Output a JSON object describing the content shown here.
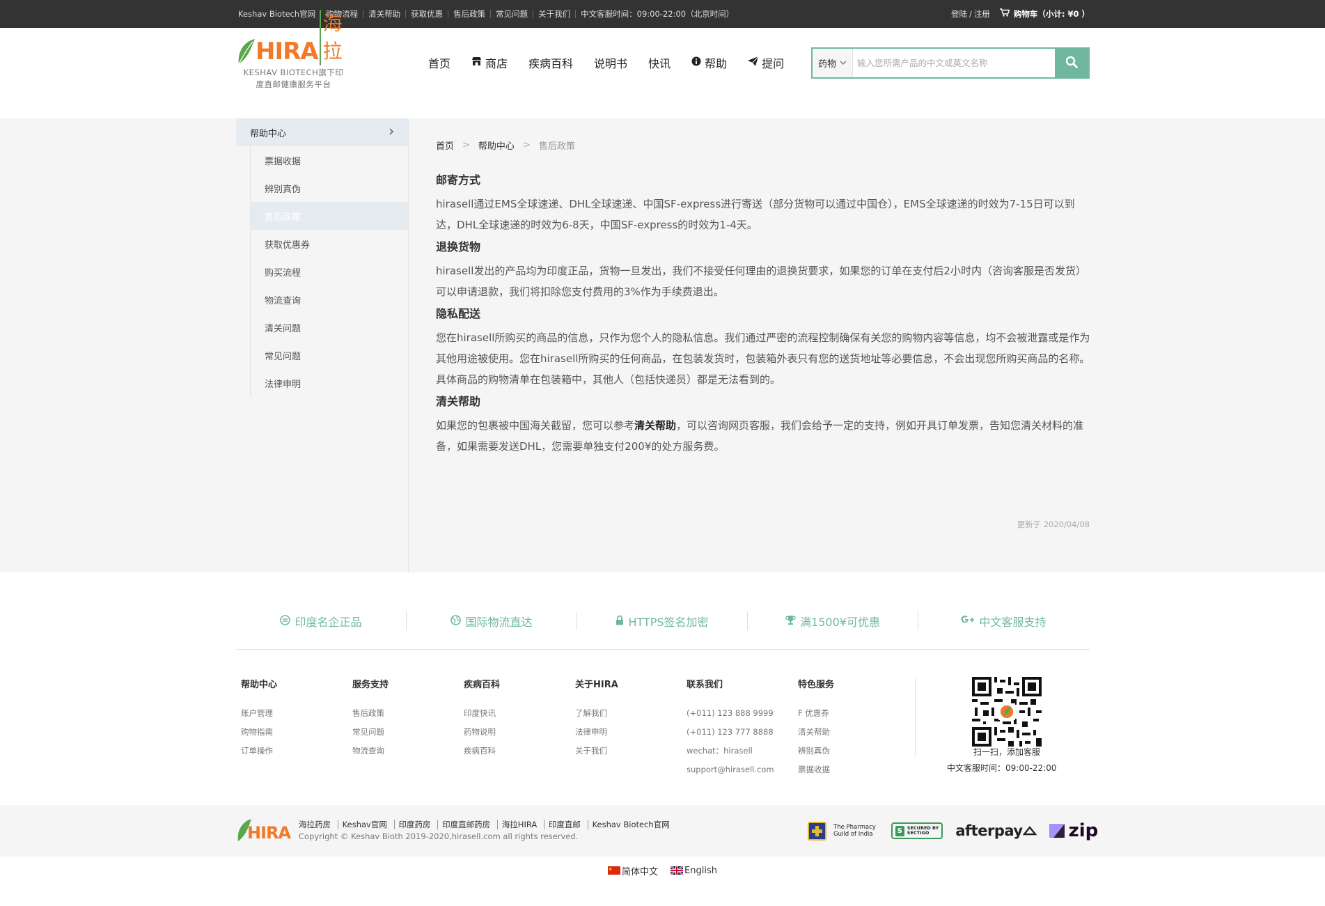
{
  "topbar": {
    "links": [
      "Keshav Biotech官网",
      "购物流程",
      "清关帮助",
      "获取优惠",
      "售后政策",
      "常见问题",
      "关于我们",
      "中文客服时间：09:00-22:00（北京时间）"
    ],
    "login": "登陆",
    "register": "注册",
    "login_sep": "/",
    "cart_label": "购物车",
    "cart_subtotal": "（小计: ¥0 ）"
  },
  "header": {
    "logo_word": "HIRA",
    "logo_cn": "海拉",
    "logo_sub_line1": "KESHAV BIOTECH旗下印",
    "logo_sub_line2": "度直邮健康服务平台",
    "nav": [
      {
        "label": "首页",
        "icon": ""
      },
      {
        "label": "商店",
        "icon": "shop-icon"
      },
      {
        "label": "疾病百科",
        "icon": ""
      },
      {
        "label": "说明书",
        "icon": ""
      },
      {
        "label": "快讯",
        "icon": ""
      },
      {
        "label": "帮助",
        "icon": "info-icon"
      },
      {
        "label": "提问",
        "icon": "paper-plane-icon"
      }
    ],
    "search": {
      "category": "药物",
      "placeholder": "输入您所需产品的中文或英文名称",
      "value": ""
    }
  },
  "sidebar": {
    "title": "帮助中心",
    "items": [
      {
        "label": "票据收据",
        "active": false
      },
      {
        "label": "辨别真伪",
        "active": false
      },
      {
        "label": "售后政策",
        "active": true
      },
      {
        "label": "获取优惠券",
        "active": false
      },
      {
        "label": "购买流程",
        "active": false
      },
      {
        "label": "物流查询",
        "active": false
      },
      {
        "label": "清关问题",
        "active": false
      },
      {
        "label": "常见问题",
        "active": false
      },
      {
        "label": "法律申明",
        "active": false
      }
    ]
  },
  "breadcrumb": {
    "home": "首页",
    "section": "帮助中心",
    "current": "售后政策",
    "sep": ">"
  },
  "article": {
    "s1_title": "邮寄方式",
    "s1_body": "hirasell通过EMS全球速递、DHL全球速递、中国SF-express进行寄送（部分货物可以通过中国仓），EMS全球速递的时效为7-15日可以到达，DHL全球速递的时效为6-8天，中国SF-express的时效为1-4天。",
    "s2_title": "退换货物",
    "s2_body": "hirasell发出的产品均为印度正品，货物一旦发出，我们不接受任何理由的退换货要求，如果您的订单在支付后2小时内（咨询客服是否发货）可以申请退款，我们将扣除您支付费用的3%作为手续费退出。",
    "s3_title": "隐私配送",
    "s3_body": "您在hirasell所购买的商品的信息，只作为您个人的隐私信息。我们通过严密的流程控制确保有关您的购物内容等信息，均不会被泄露或是作为其他用途被使用。您在hirasell所购买的任何商品，在包装发货时，包装箱外表只有您的送货地址等必要信息，不会出现您所购买商品的名称。具体商品的购物清单在包装箱中，其他人（包括快递员）都是无法看到的。",
    "s4_title": "清关帮助",
    "s4_body_pre": "如果您的包裹被中国海关截留，您可以参考",
    "s4_link": "清关帮助",
    "s4_body_post": "，可以咨询网页客服，我们会给予一定的支持，例如开具订单发票，告知您清关材料的准备，如果需要发送DHL，您需要单独支付200¥的处方服务费。",
    "updated": "更新于 2020/04/08"
  },
  "features": [
    {
      "label": "印度名企正品",
      "icon": "certificate-icon"
    },
    {
      "label": "国际物流直达",
      "icon": "globe-icon"
    },
    {
      "label": "HTTPS签名加密",
      "icon": "lock-icon"
    },
    {
      "label": "满1500¥可优惠",
      "icon": "trophy-icon"
    },
    {
      "label": "中文客服支持",
      "icon": "google-plus-icon"
    }
  ],
  "footer": {
    "columns": [
      {
        "title": "帮助中心",
        "links": [
          "账户管理",
          "购物指南",
          "订单操作"
        ]
      },
      {
        "title": "服务支持",
        "links": [
          "售后政策",
          "常见问题",
          "物流查询"
        ]
      },
      {
        "title": "疾病百科",
        "links": [
          "印度快讯",
          "药物说明",
          "疾病百科"
        ]
      },
      {
        "title": "关于HIRA",
        "links": [
          "了解我们",
          "法律申明",
          "关于我们"
        ]
      },
      {
        "title": "联系我们",
        "links": [
          "(+011) 123 888 9999",
          "(+011) 123 777 8888",
          "wechat：hirasell",
          "support@hirasell.com"
        ]
      },
      {
        "title": "特色服务",
        "links": [
          "F 优惠券",
          "清关帮助",
          "辨别真伪",
          "票据收据"
        ]
      }
    ],
    "qr_caption": "扫一扫，添加客服",
    "service_time": "中文客服时间：09:00-22:00"
  },
  "bottom": {
    "links": [
      "海拉药房",
      "Keshav官网",
      "印度药房",
      "印度直邮药房",
      "海拉HIRA",
      "印度直邮",
      "Keshav Biotech官网"
    ],
    "copyright": "Copyright © Keshav Bioth 2019-2020,hirasell.com all rights reserved.",
    "pgi_line1": "The Pharmacy",
    "pgi_line2": "Guild of India",
    "sectigo_line1": "SECURED BY",
    "sectigo_line2": "SECTIGO",
    "afterpay": "afterpay",
    "zip": "zip"
  },
  "lang": {
    "zh": "简体中文",
    "en": "English"
  },
  "colors": {
    "accent": "#6fb89f",
    "topbar": "#333333",
    "logo_orange": "#f07a2a",
    "logo_green": "#5aa84d"
  }
}
